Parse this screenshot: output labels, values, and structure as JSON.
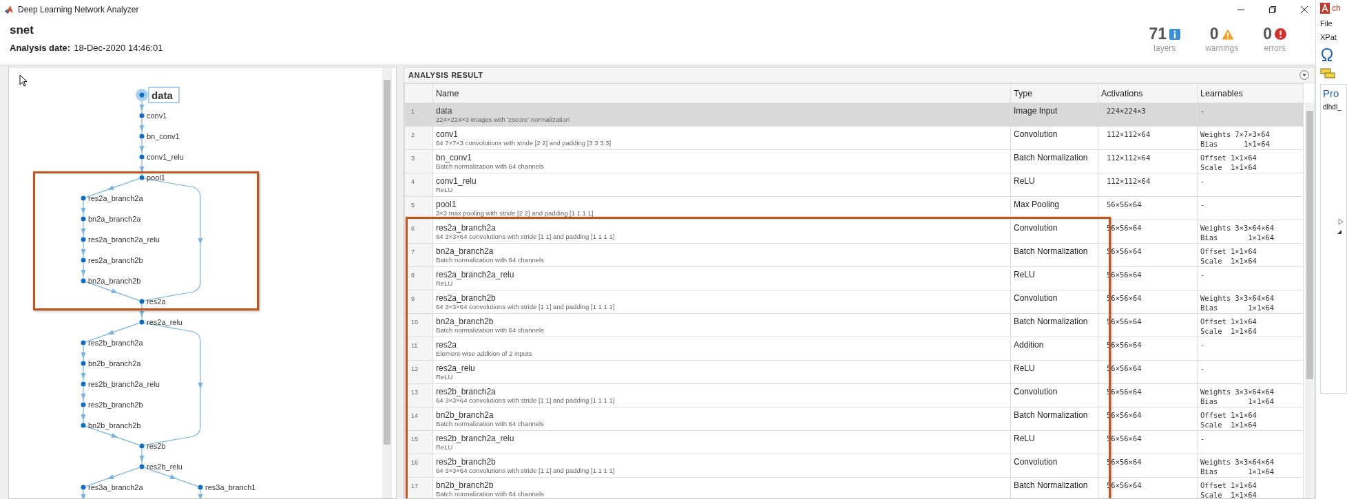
{
  "window": {
    "title": "Deep Learning Network Analyzer"
  },
  "header": {
    "network_name": "snet",
    "date_label": "Analysis date:",
    "date_value": "18-Dec-2020 14:46:01",
    "stats": [
      {
        "value": "71",
        "label": "layers",
        "kind": "info"
      },
      {
        "value": "0",
        "label": "warnings",
        "kind": "warning"
      },
      {
        "value": "0",
        "label": "errors",
        "kind": "error"
      }
    ]
  },
  "graph": {
    "nodes": [
      {
        "label": "data",
        "kind": "trunk",
        "selected": true
      },
      {
        "label": "conv1",
        "kind": "trunk",
        "selected": false
      },
      {
        "label": "bn_conv1",
        "kind": "trunk",
        "selected": false
      },
      {
        "label": "conv1_relu",
        "kind": "trunk",
        "selected": false
      },
      {
        "label": "pool1",
        "kind": "trunk",
        "selected": false
      },
      {
        "label": "res2a_branch2a",
        "kind": "branch",
        "selected": false
      },
      {
        "label": "bn2a_branch2a",
        "kind": "branch",
        "selected": false
      },
      {
        "label": "res2a_branch2a_relu",
        "kind": "branch",
        "selected": false
      },
      {
        "label": "res2a_branch2b",
        "kind": "branch",
        "selected": false
      },
      {
        "label": "bn2a_branch2b",
        "kind": "branch",
        "selected": false
      },
      {
        "label": "res2a",
        "kind": "trunk",
        "selected": false
      },
      {
        "label": "res2a_relu",
        "kind": "trunk",
        "selected": false
      },
      {
        "label": "res2b_branch2a",
        "kind": "branch",
        "selected": false
      },
      {
        "label": "bn2b_branch2a",
        "kind": "branch",
        "selected": false
      },
      {
        "label": "res2b_branch2a_relu",
        "kind": "branch",
        "selected": false
      },
      {
        "label": "res2b_branch2b",
        "kind": "branch",
        "selected": false
      },
      {
        "label": "bn2b_branch2b",
        "kind": "branch",
        "selected": false
      },
      {
        "label": "res2b",
        "kind": "trunk",
        "selected": false
      },
      {
        "label": "res2b_relu",
        "kind": "trunk",
        "selected": false
      },
      {
        "label": "res3a_branch2a",
        "kind": "branch",
        "selected": false
      },
      {
        "label": "res3a_branch1",
        "kind": "side",
        "selected": false
      }
    ]
  },
  "analysis": {
    "title": "ANALYSIS RESULT",
    "columns": [
      "Name",
      "Type",
      "Activations",
      "Learnables"
    ],
    "rows": [
      {
        "number": "1",
        "name": "data",
        "description": "224×224×3 images with 'zscore' normalization",
        "type": "Image Input",
        "activations": "224×224×3",
        "learnables_text": "-",
        "selected": true
      },
      {
        "number": "2",
        "name": "conv1",
        "description": "64 7×7×3 convolutions with stride [2 2] and padding [3 3 3 3]",
        "type": "Convolution",
        "activations": "112×112×64",
        "learnables": [
          {
            "name": "Weights",
            "value": "7×7×3×64"
          },
          {
            "name": "Bias",
            "value": "1×1×64"
          }
        ],
        "selected": false
      },
      {
        "number": "3",
        "name": "bn_conv1",
        "description": "Batch normalization with 64 channels",
        "type": "Batch Normalization",
        "activations": "112×112×64",
        "learnables": [
          {
            "name": "Offset",
            "value": "1×1×64"
          },
          {
            "name": "Scale",
            "value": "1×1×64"
          }
        ],
        "selected": false
      },
      {
        "number": "4",
        "name": "conv1_relu",
        "description": "ReLU",
        "type": "ReLU",
        "activations": "112×112×64",
        "learnables_text": "-",
        "selected": false
      },
      {
        "number": "5",
        "name": "pool1",
        "description": "3×3 max pooling with stride [2 2] and padding [1 1 1 1]",
        "type": "Max Pooling",
        "activations": "56×56×64",
        "learnables_text": "-",
        "selected": false
      },
      {
        "number": "6",
        "name": "res2a_branch2a",
        "description": "64 3×3×64 convolutions with stride [1 1] and padding [1 1 1 1]",
        "type": "Convolution",
        "activations": "56×56×64",
        "learnables": [
          {
            "name": "Weights",
            "value": "3×3×64×64"
          },
          {
            "name": "Bias",
            "value": "1×1×64"
          }
        ],
        "selected": false
      },
      {
        "number": "7",
        "name": "bn2a_branch2a",
        "description": "Batch normalization with 64 channels",
        "type": "Batch Normalization",
        "activations": "56×56×64",
        "learnables": [
          {
            "name": "Offset",
            "value": "1×1×64"
          },
          {
            "name": "Scale",
            "value": "1×1×64"
          }
        ],
        "selected": false
      },
      {
        "number": "8",
        "name": "res2a_branch2a_relu",
        "description": "ReLU",
        "type": "ReLU",
        "activations": "56×56×64",
        "learnables_text": "-",
        "selected": false
      },
      {
        "number": "9",
        "name": "res2a_branch2b",
        "description": "64 3×3×64 convolutions with stride [1 1] and padding [1 1 1 1]",
        "type": "Convolution",
        "activations": "56×56×64",
        "learnables": [
          {
            "name": "Weights",
            "value": "3×3×64×64"
          },
          {
            "name": "Bias",
            "value": "1×1×64"
          }
        ],
        "selected": false
      },
      {
        "number": "10",
        "name": "bn2a_branch2b",
        "description": "Batch normalization with 64 channels",
        "type": "Batch Normalization",
        "activations": "56×56×64",
        "learnables": [
          {
            "name": "Offset",
            "value": "1×1×64"
          },
          {
            "name": "Scale",
            "value": "1×1×64"
          }
        ],
        "selected": false
      },
      {
        "number": "11",
        "name": "res2a",
        "description": "Element-wise addition of 2 inputs",
        "type": "Addition",
        "activations": "56×56×64",
        "learnables_text": "-",
        "selected": false
      },
      {
        "number": "12",
        "name": "res2a_relu",
        "description": "ReLU",
        "type": "ReLU",
        "activations": "56×56×64",
        "learnables_text": "-",
        "selected": false
      },
      {
        "number": "13",
        "name": "res2b_branch2a",
        "description": "64 3×3×64 convolutions with stride [1 1] and padding [1 1 1 1]",
        "type": "Convolution",
        "activations": "56×56×64",
        "learnables": [
          {
            "name": "Weights",
            "value": "3×3×64×64"
          },
          {
            "name": "Bias",
            "value": "1×1×64"
          }
        ],
        "selected": false
      },
      {
        "number": "14",
        "name": "bn2b_branch2a",
        "description": "Batch normalization with 64 channels",
        "type": "Batch Normalization",
        "activations": "56×56×64",
        "learnables": [
          {
            "name": "Offset",
            "value": "1×1×64"
          },
          {
            "name": "Scale",
            "value": "1×1×64"
          }
        ],
        "selected": false
      },
      {
        "number": "15",
        "name": "res2b_branch2a_relu",
        "description": "ReLU",
        "type": "ReLU",
        "activations": "56×56×64",
        "learnables_text": "-",
        "selected": false
      },
      {
        "number": "16",
        "name": "res2b_branch2b",
        "description": "64 3×3×64 convolutions with stride [1 1] and padding [1 1 1 1]",
        "type": "Convolution",
        "activations": "56×56×64",
        "learnables": [
          {
            "name": "Weights",
            "value": "3×3×64×64"
          },
          {
            "name": "Bias",
            "value": "1×1×64"
          }
        ],
        "selected": false
      },
      {
        "number": "17",
        "name": "bn2b_branch2b",
        "description": "Batch normalization with 64 channels",
        "type": "Batch Normalization",
        "activations": "56×56×64",
        "learnables": [
          {
            "name": "Offset",
            "value": "1×1×64"
          },
          {
            "name": "Scale",
            "value": "1×1×64"
          }
        ],
        "selected": false
      }
    ]
  },
  "side_panel": {
    "app_label": "ch",
    "menu": "File",
    "toolbar_label": "XPat",
    "section_title": "Pro",
    "item": "dlhdl_"
  }
}
